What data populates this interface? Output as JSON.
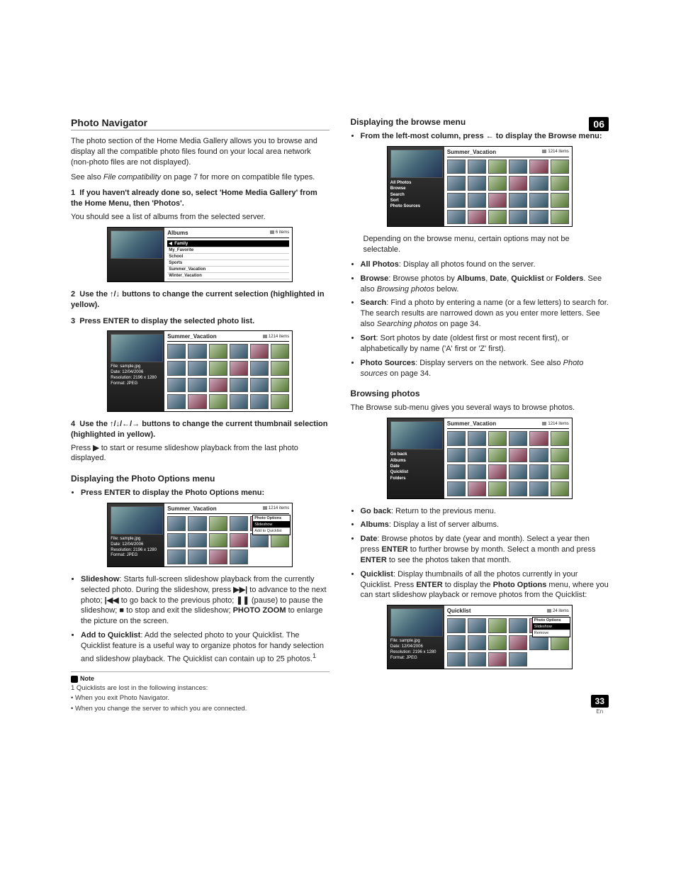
{
  "chapter": "06",
  "page_number": "33",
  "page_lang": "En",
  "left": {
    "heading": "Photo Navigator",
    "intro": "The photo section of the Home Media Gallery allows you to browse and display all the compatible photo files found on your local area network (non-photo files are not displayed).",
    "see_also": "See also File compatibility on page 7 for more on compatible file types.",
    "step1_num": "1",
    "step1_bold": "If you haven't already done so, select 'Home Media Gallery' from the Home Menu, then 'Photos'.",
    "step1_after": "You should see a list of albums from the selected server.",
    "shot1": {
      "title": "Albums",
      "count": "6 items",
      "items": [
        "Family",
        "My_Favorite",
        "School",
        "Sports",
        "Summer_Vacation",
        "Winter_Vacation"
      ]
    },
    "step2_num": "2",
    "step2_pre": "Use the ",
    "step2_arrows": "↑/↓",
    "step2_post": " buttons to change the current selection (highlighted in yellow).",
    "step3_num": "3",
    "step3_text": "Press ENTER to display the selected photo list.",
    "shot2": {
      "title": "Summer_Vacation",
      "count": "1214 items",
      "meta": [
        "File: sample.jpg",
        "Date: 12/04/2006",
        "Resolution: 2196 x 1280",
        "Format: JPEG"
      ]
    },
    "step4_num": "4",
    "step4_pre": "Use the ",
    "step4_arrows": "↑/↓/←/→",
    "step4_post": " buttons to change the current thumbnail selection (highlighted in yellow).",
    "step4_after_pre": "Press ",
    "step4_after_glyph": "▶",
    "step4_after_post": " to start or resume slideshow playback from the last photo displayed.",
    "options_heading": "Displaying the Photo Options menu",
    "options_bullet": "Press ENTER to display the Photo Options menu:",
    "shot3": {
      "title": "Summer_Vacation",
      "count": "1214 items",
      "meta": [
        "File: sample.jpg",
        "Date: 12/04/2006",
        "Resolution: 2196 x 1280",
        "Format: JPEG"
      ],
      "popup_header": "Photo Options",
      "popup_items": [
        "Slideshow",
        "Add to Quicklist"
      ]
    },
    "opt_bullets": [
      {
        "b": "Slideshow",
        "t": ": Starts full-screen slideshow playback from the currently selected photo. During the slideshow, press ▶▶| to advance to the next photo; |◀◀ to go back to the previous photo; ❚❚ (pause) to pause the slideshow; ■ to stop and exit the slideshow; PHOTO ZOOM to enlarge the picture on the screen.",
        "b2": "PHOTO ZOOM"
      },
      {
        "b": "Add to Quicklist",
        "t": ": Add the selected photo to your Quicklist. The Quicklist feature is a useful way to organize photos for handy selection and slideshow playback. The Quicklist can contain up to 25 photos.",
        "sup": "1"
      }
    ],
    "note_label": "Note",
    "footnotes": [
      "1 Quicklists are lost in the following instances:",
      "• When you exit Photo Navigator.",
      "• When you change the server to which you are connected."
    ]
  },
  "right": {
    "heading": "Displaying the browse menu",
    "bullet_pre": "From the left-most column, press ",
    "bullet_arrow": "←",
    "bullet_post": " to display the Browse menu:",
    "shot4": {
      "title": "Summer_Vacation",
      "count": "1214 items",
      "nav": [
        "All Photos",
        "Browse",
        "Search",
        "Sort",
        "Photo Sources"
      ]
    },
    "depending": "Depending on the browse menu, certain options may not be selectable.",
    "brw_bullets": [
      {
        "b": "All Photos",
        "t": ": Display all photos found on the server."
      },
      {
        "b": "Browse",
        "t": ": Browse photos by Albums, Date, Quicklist or Folders. See also Browsing photos below.",
        "bolds": [
          "Albums",
          "Date",
          "Quicklist",
          "Folders"
        ],
        "em": "Browsing photos"
      },
      {
        "b": "Search",
        "t": ": Find a photo by entering a name (or a few letters) to search for. The search results are narrowed down as you enter more letters. See also Searching photos on page 34.",
        "em": "Searching photos"
      },
      {
        "b": "Sort",
        "t": ": Sort photos by date (oldest first or most recent first), or alphabetically by name ('A' first or 'Z' first)."
      },
      {
        "b": "Photo Sources",
        "t": ": Display servers on the network. See also Photo sources on page 34.",
        "em": "Photo sources"
      }
    ],
    "browsing_heading": "Browsing photos",
    "browsing_intro": "The Browse sub-menu gives you several ways to browse photos.",
    "shot5": {
      "title": "Summer_Vacation",
      "count": "1214 items",
      "nav": [
        "Go back",
        "Albums",
        "Date",
        "Quicklist",
        "Folders"
      ]
    },
    "brw2_bullets": [
      {
        "b": "Go back",
        "t": ": Return to the previous menu."
      },
      {
        "b": "Albums",
        "t": ": Display a list of server albums."
      },
      {
        "b": "Date",
        "t": ": Browse photos by date (year and month). Select a year then press ENTER to further browse by month. Select a month and press ENTER to see the photos taken that month.",
        "bolds": [
          "ENTER",
          "ENTER"
        ]
      },
      {
        "b": "Quicklist",
        "t": ": Display thumbnails of all the photos currently in your Quicklist. Press ENTER to display the Photo Options menu, where you can start slideshow playback or remove photos from the Quicklist:",
        "bolds": [
          "ENTER",
          "Photo Options"
        ]
      }
    ],
    "shot6": {
      "title": "Quicklist",
      "count": "24 items",
      "meta": [
        "File: sample.jpg",
        "Date: 12/04/2006",
        "Resolution: 2196 x 1280",
        "Format: JPEG"
      ],
      "popup_header": "Photo Options",
      "popup_items": [
        "Slideshow",
        "Remove"
      ]
    }
  }
}
